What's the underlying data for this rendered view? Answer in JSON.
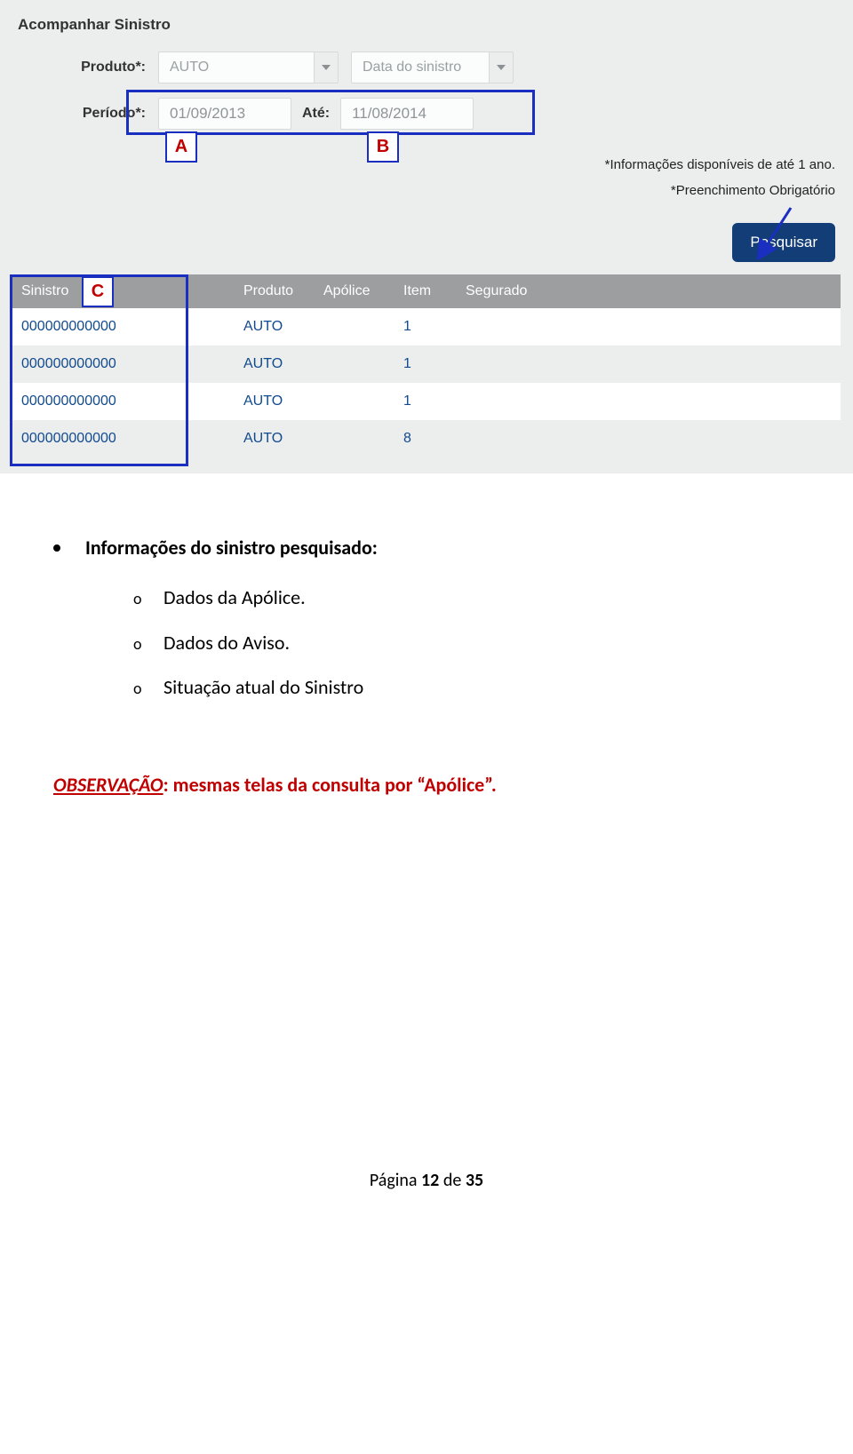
{
  "panel": {
    "title": "Acompanhar Sinistro",
    "produto_label": "Produto*:",
    "produto_value": "AUTO",
    "data_sinistro_placeholder": "Data do sinistro",
    "periodo_label": "Período*:",
    "periodo_from": "01/09/2013",
    "ate_label": "Até:",
    "periodo_to": "11/08/2014",
    "note1": "*Informações disponíveis de até 1 ano.",
    "note2": "*Preenchimento Obrigatório",
    "search_label": "Pesquisar"
  },
  "markers": {
    "a": "A",
    "b": "B",
    "c": "C"
  },
  "table": {
    "headers": {
      "sinistro": "Sinistro",
      "produto": "Produto",
      "apolice": "Apólice",
      "item": "Item",
      "segurado": "Segurado"
    },
    "rows": [
      {
        "sinistro": "000000000000",
        "produto": "AUTO",
        "apolice": "",
        "item": "1",
        "segurado": ""
      },
      {
        "sinistro": "000000000000",
        "produto": "AUTO",
        "apolice": "",
        "item": "1",
        "segurado": ""
      },
      {
        "sinistro": "000000000000",
        "produto": "AUTO",
        "apolice": "",
        "item": "1",
        "segurado": ""
      },
      {
        "sinistro": "000000000000",
        "produto": "AUTO",
        "apolice": "",
        "item": "8",
        "segurado": ""
      }
    ]
  },
  "doc": {
    "heading": "Informações do sinistro pesquisado:",
    "sub1": "Dados da Apólice.",
    "sub2": "Dados do Aviso.",
    "sub3": "Situação atual do Sinistro",
    "obs_label": "OBSERVAÇÃO",
    "obs_rest": ": mesmas telas da consulta por “Apólice”.",
    "footer_pre": "Página ",
    "footer_cur": "12",
    "footer_mid": " de ",
    "footer_tot": "35"
  }
}
